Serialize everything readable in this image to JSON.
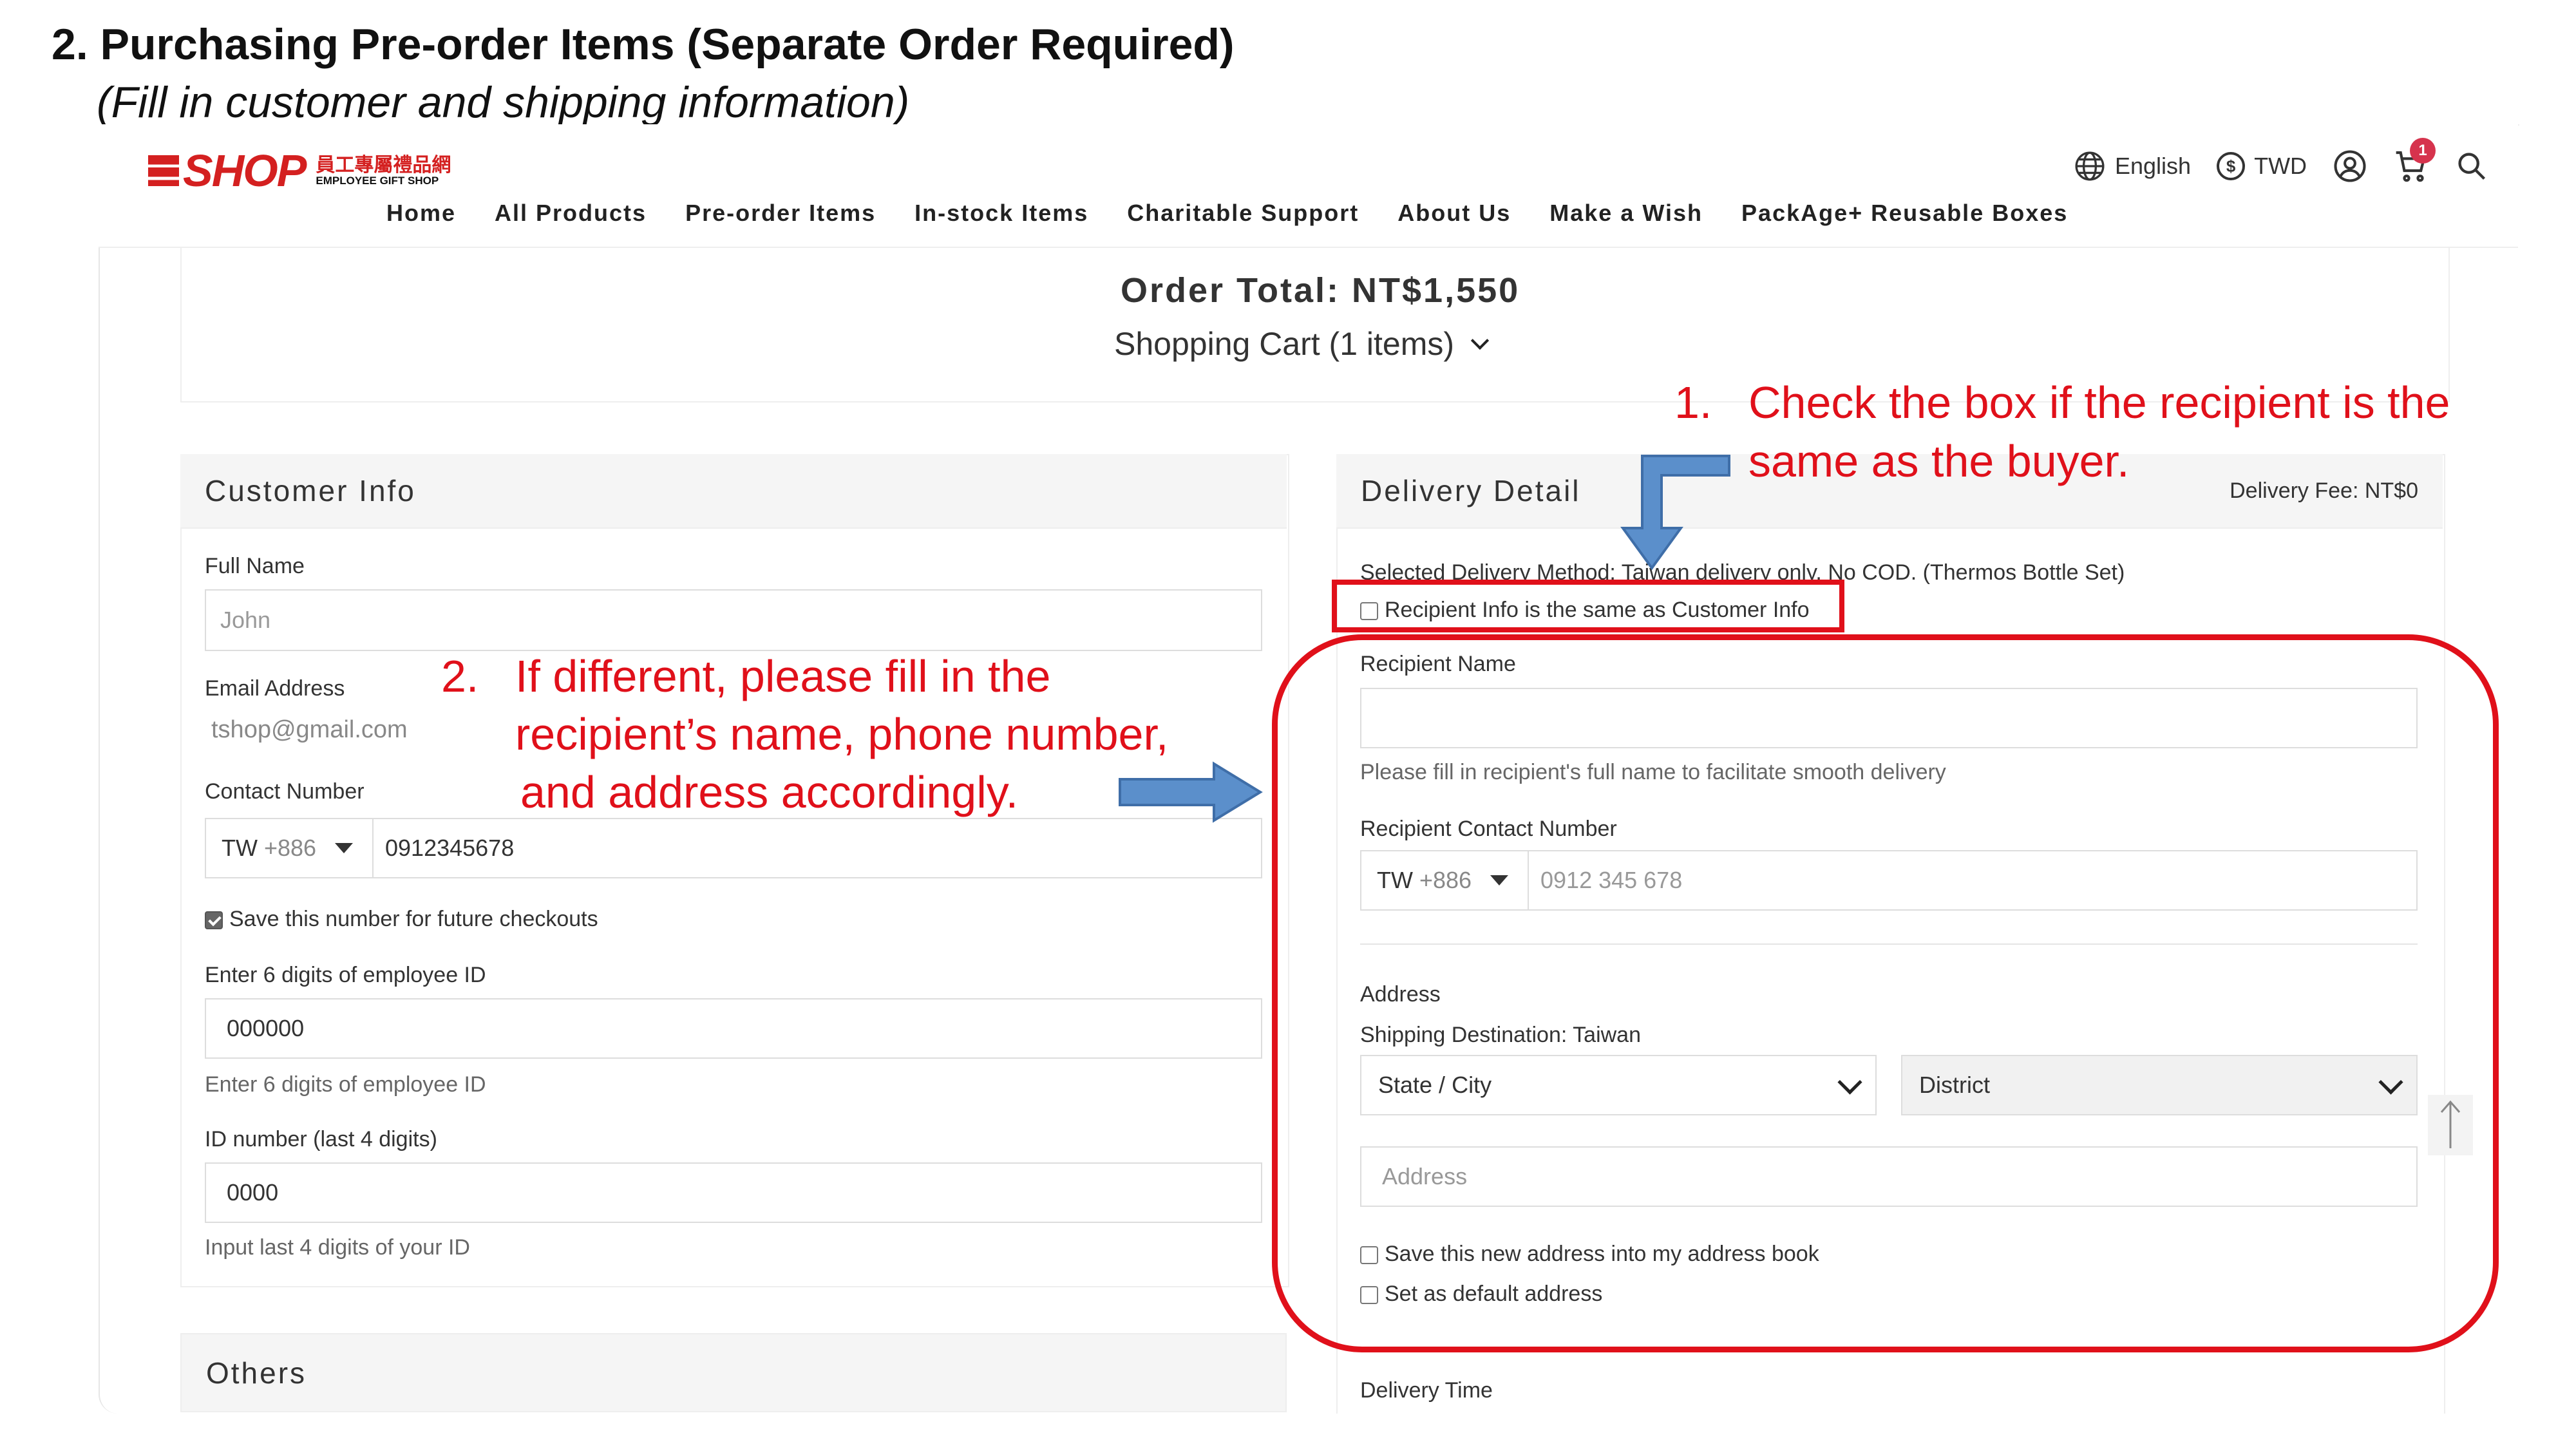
{
  "slide": {
    "title": "2. Purchasing Pre-order Items (Separate Order Required)",
    "subtitle": "(Fill in customer and shipping information)"
  },
  "header": {
    "logo_text": "SHOP",
    "logo_cn": "員工專屬禮品網",
    "logo_en": "EMPLOYEE GIFT SHOP",
    "language": "English",
    "currency": "TWD",
    "currency_symbol": "$",
    "cart_count": "1",
    "nav": [
      "Home",
      "All Products",
      "Pre-order Items",
      "In-stock Items",
      "Charitable Support",
      "About Us",
      "Make a Wish",
      "PackAge+ Reusable Boxes"
    ]
  },
  "order": {
    "total": "Order Total: NT$1,550",
    "cart": "Shopping Cart (1 items)"
  },
  "customer": {
    "title": "Customer Info",
    "full_name_label": "Full Name",
    "full_name_placeholder": "John",
    "email_label": "Email Address",
    "email_value": "tshop@gmail.com",
    "contact_label": "Contact Number",
    "country": "TW",
    "dial_code": "+886",
    "phone_value": "0912345678",
    "save_number": "Save this number for future checkouts",
    "employee_label": "Enter 6 digits of employee ID",
    "employee_value": "000000",
    "employee_hint": "Enter 6 digits of employee ID",
    "id_label": "ID number (last 4 digits)",
    "id_value": "0000",
    "id_hint": "Input last 4 digits of your ID"
  },
  "others": {
    "title": "Others"
  },
  "delivery": {
    "title": "Delivery Detail",
    "fee": "Delivery Fee: NT$0",
    "method": "Selected Delivery Method: Taiwan delivery only. No COD. (Thermos Bottle Set)",
    "same_as_customer": "Recipient Info is the same as Customer Info",
    "recipient_name_label": "Recipient Name",
    "recipient_name_hint": "Please fill in recipient's full name to facilitate smooth delivery",
    "recipient_contact_label": "Recipient Contact Number",
    "country": "TW",
    "dial_code": "+886",
    "phone_placeholder": "0912 345 678",
    "address_label": "Address",
    "destination": "Shipping Destination: Taiwan",
    "state_city": "State / City",
    "district": "District",
    "address_placeholder": "Address",
    "save_address": "Save this new address into my address book",
    "default_address": "Set as default address",
    "delivery_time": "Delivery Time"
  },
  "annotations": {
    "a1_num": "1.",
    "a1_line1": "Check the box if the recipient is the",
    "a1_line2": "same as the buyer.",
    "a2_num": "2.",
    "a2_line1": "If different, please fill in the",
    "a2_line2": "recipient’s name, phone number,",
    "a2_line3": "and address accordingly."
  },
  "colors": {
    "annotation_red": "#e0101a",
    "arrow_blue": "#5b8fcb",
    "badge": "#d6334d"
  }
}
